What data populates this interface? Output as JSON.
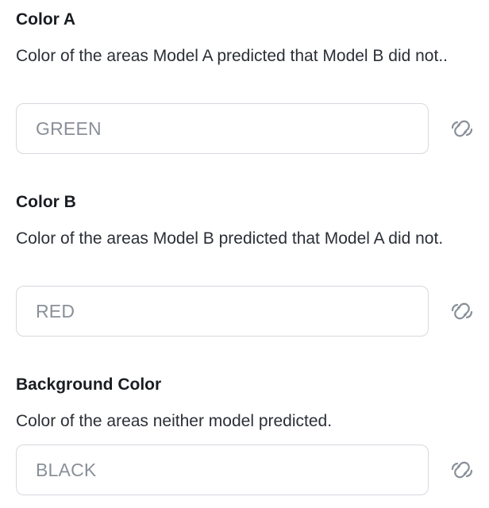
{
  "fields": [
    {
      "label": "Color A",
      "description": "Color of the areas Model A predicted that Model B did not..",
      "value": "GREEN",
      "link_icon": "link-icon"
    },
    {
      "label": "Color B",
      "description": "Color of the areas Model B predicted that Model A did not.",
      "value": "RED",
      "link_icon": "link-icon"
    },
    {
      "label": "Background Color",
      "description": "Color of the areas neither model predicted.",
      "value": "BLACK",
      "link_icon": "link-icon"
    }
  ],
  "colors": {
    "label": "#1a1d21",
    "description": "#2b2f36",
    "input_border": "#d5d9df",
    "input_value": "#8a9099",
    "icon": "#8a9099"
  }
}
